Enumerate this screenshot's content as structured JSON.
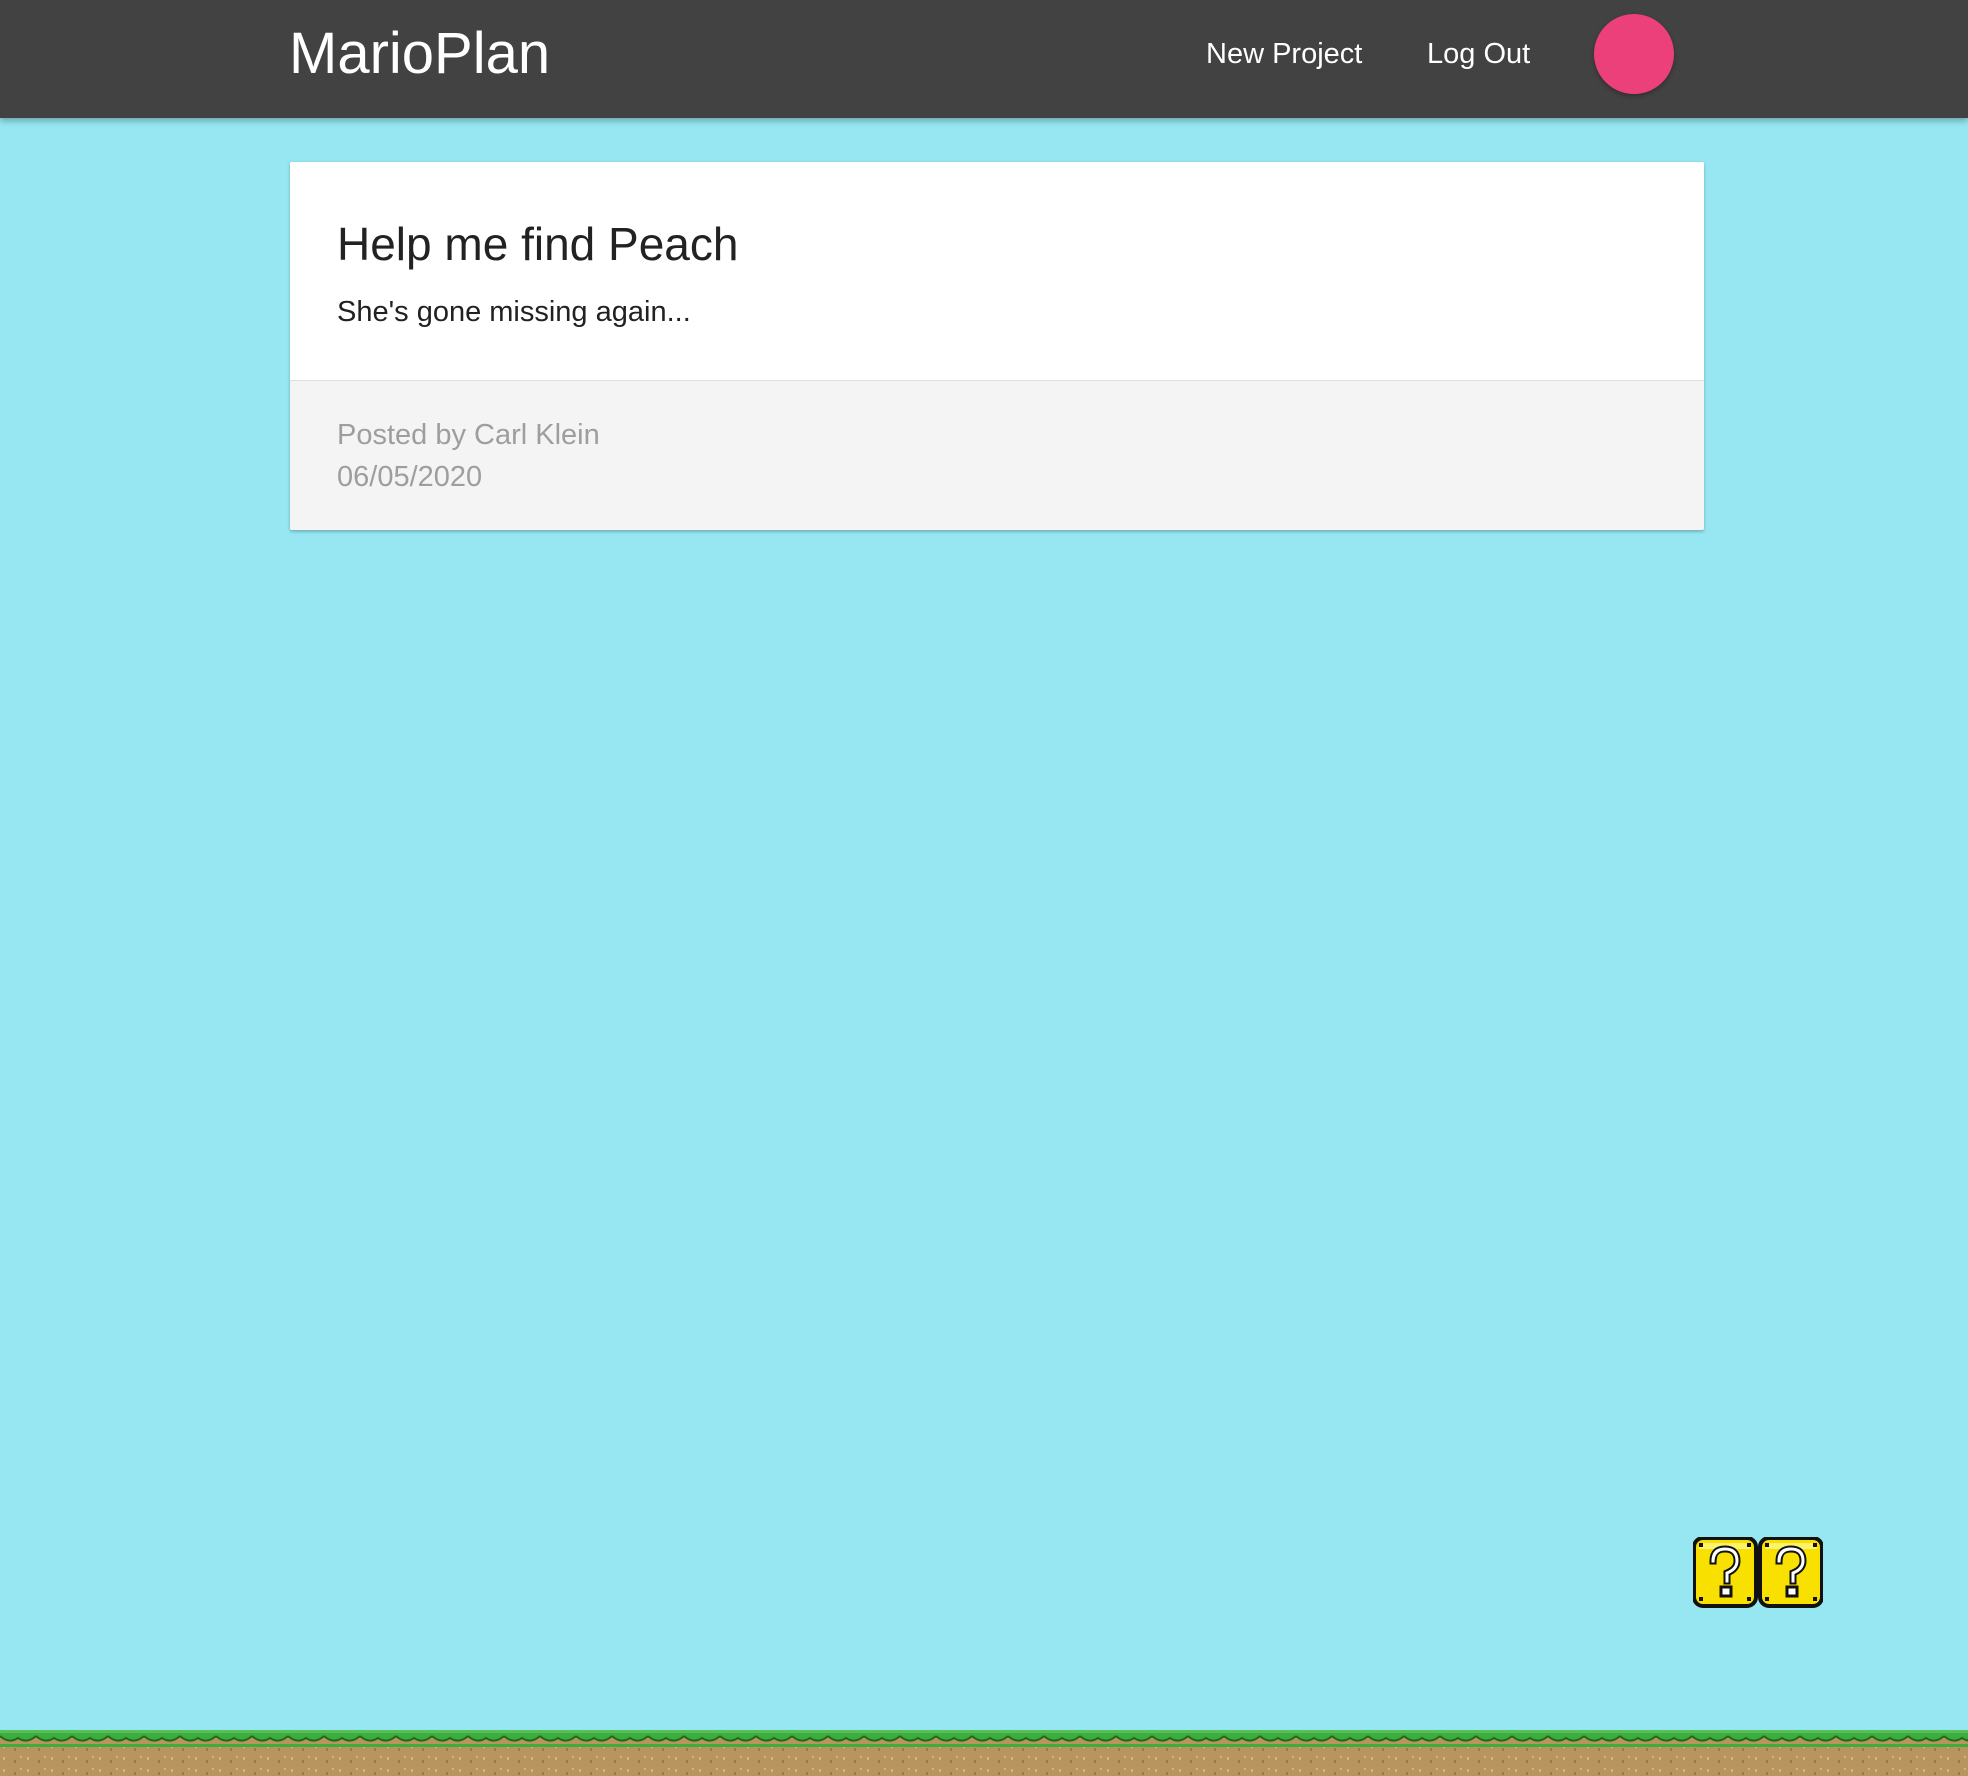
{
  "navbar": {
    "brand": "MarioPlan",
    "links": {
      "new_project": "New Project",
      "log_out": "Log Out"
    },
    "avatar_color": "#ec407a",
    "background": "#424242"
  },
  "project": {
    "title": "Help me find Peach",
    "content": "She's gone missing again...",
    "author_line": "Posted by Carl Klein",
    "date": "06/05/2020"
  },
  "scene": {
    "sky_color": "#96e7f2",
    "decorations": [
      "question-block-icon",
      "question-block-icon",
      "grass-ground"
    ]
  }
}
